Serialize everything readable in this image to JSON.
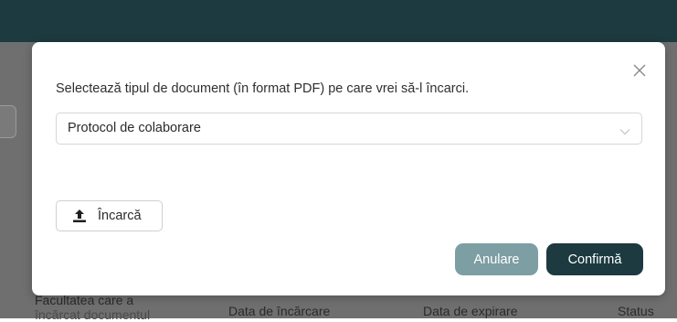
{
  "colors": {
    "topbar": "#1c3a3f",
    "backdrop": "#6f6f6f",
    "cancel_button": "#7d9ea3",
    "confirm_button": "#1c3a3f"
  },
  "background_table": {
    "columns": [
      "Facultatea care a",
      "Data de încărcare",
      "Data de expirare",
      "Status"
    ],
    "col1_second_line": "încărcat documentul"
  },
  "modal": {
    "prompt": "Selectează tipul de document (în format PDF) pe care vrei să-l încarci.",
    "document_type_select": {
      "value": "Protocol de colaborare",
      "icon": "chevron-down-icon"
    },
    "upload_button": {
      "label": "Încarcă",
      "icon": "upload-icon"
    },
    "cancel_label": "Anulare",
    "confirm_label": "Confirmă",
    "close_icon": "close-icon"
  }
}
